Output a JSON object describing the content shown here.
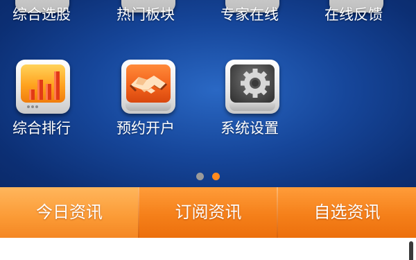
{
  "launcher": {
    "row1": [
      {
        "label": "综合选股",
        "icon": "stock-picker-icon"
      },
      {
        "label": "热门板块",
        "icon": "hot-sectors-icon"
      },
      {
        "label": "专家在线",
        "icon": "expert-online-icon"
      },
      {
        "label": "在线反馈",
        "icon": "feedback-icon"
      }
    ],
    "row2": [
      {
        "label": "综合排行",
        "icon": "bar-chart-icon"
      },
      {
        "label": "预约开户",
        "icon": "handshake-icon"
      },
      {
        "label": "系统设置",
        "icon": "gear-icon"
      }
    ],
    "pager": {
      "pages": 2,
      "current": 2
    }
  },
  "tabs": [
    {
      "label": "今日资讯",
      "active": true
    },
    {
      "label": "订阅资讯",
      "active": false
    },
    {
      "label": "自选资讯",
      "active": false
    }
  ],
  "colors": {
    "background": "#16469a",
    "tab_bar": "#f5801a",
    "tab_active": "#fb9a35",
    "pager_active": "#ff8a1f",
    "pager_inactive": "#9a9a9a"
  }
}
